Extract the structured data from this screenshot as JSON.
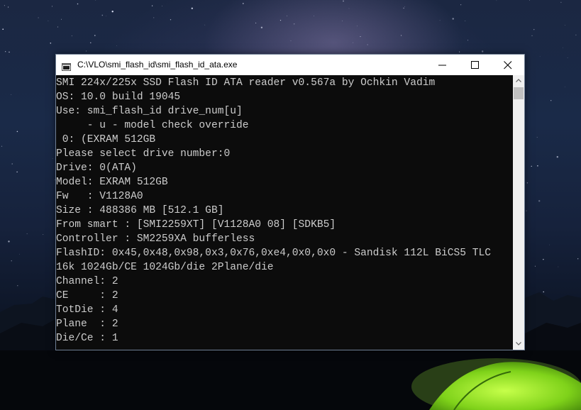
{
  "window": {
    "title": "C:\\VLO\\smi_flash_id\\smi_flash_id_ata.exe",
    "app_icon": "console-app-icon",
    "controls": {
      "minimize_icon": "minimize-icon",
      "maximize_icon": "maximize-icon",
      "close_icon": "close-icon"
    }
  },
  "console": {
    "lines": [
      "SMI 224x/225x SSD Flash ID ATA reader v0.567a by Ochkin Vadim",
      "OS: 10.0 build 19045",
      "Use: smi_flash_id drive_num[u]",
      "     - u - model check override",
      " 0: (EXRAM 512GB",
      "Please select drive number:0",
      "Drive: 0(ATA)",
      "Model: EXRAM 512GB",
      "Fw   : V1128A0",
      "Size : 488386 MB [512.1 GB]",
      "From smart : [SMI2259XT] [V1128A0 08] [SDKB5]",
      "Controller : SM2259XA bufferless",
      "FlashID: 0x45,0x48,0x98,0x3,0x76,0xe4,0x0,0x0 - Sandisk 112L BiCS5 TLC",
      "16k 1024Gb/CE 1024Gb/die 2Plane/die",
      "Channel: 2",
      "CE     : 2",
      "TotDie : 4",
      "Plane  : 2",
      "Die/Ce : 1"
    ],
    "text_color": "#cccccc",
    "background_color": "#0c0c0c"
  },
  "scrollbar": {
    "up_icon": "scroll-up-arrow-icon",
    "down_icon": "scroll-down-arrow-icon"
  },
  "desktop": {
    "wallpaper": "night-sky-mountains-green-tent"
  }
}
